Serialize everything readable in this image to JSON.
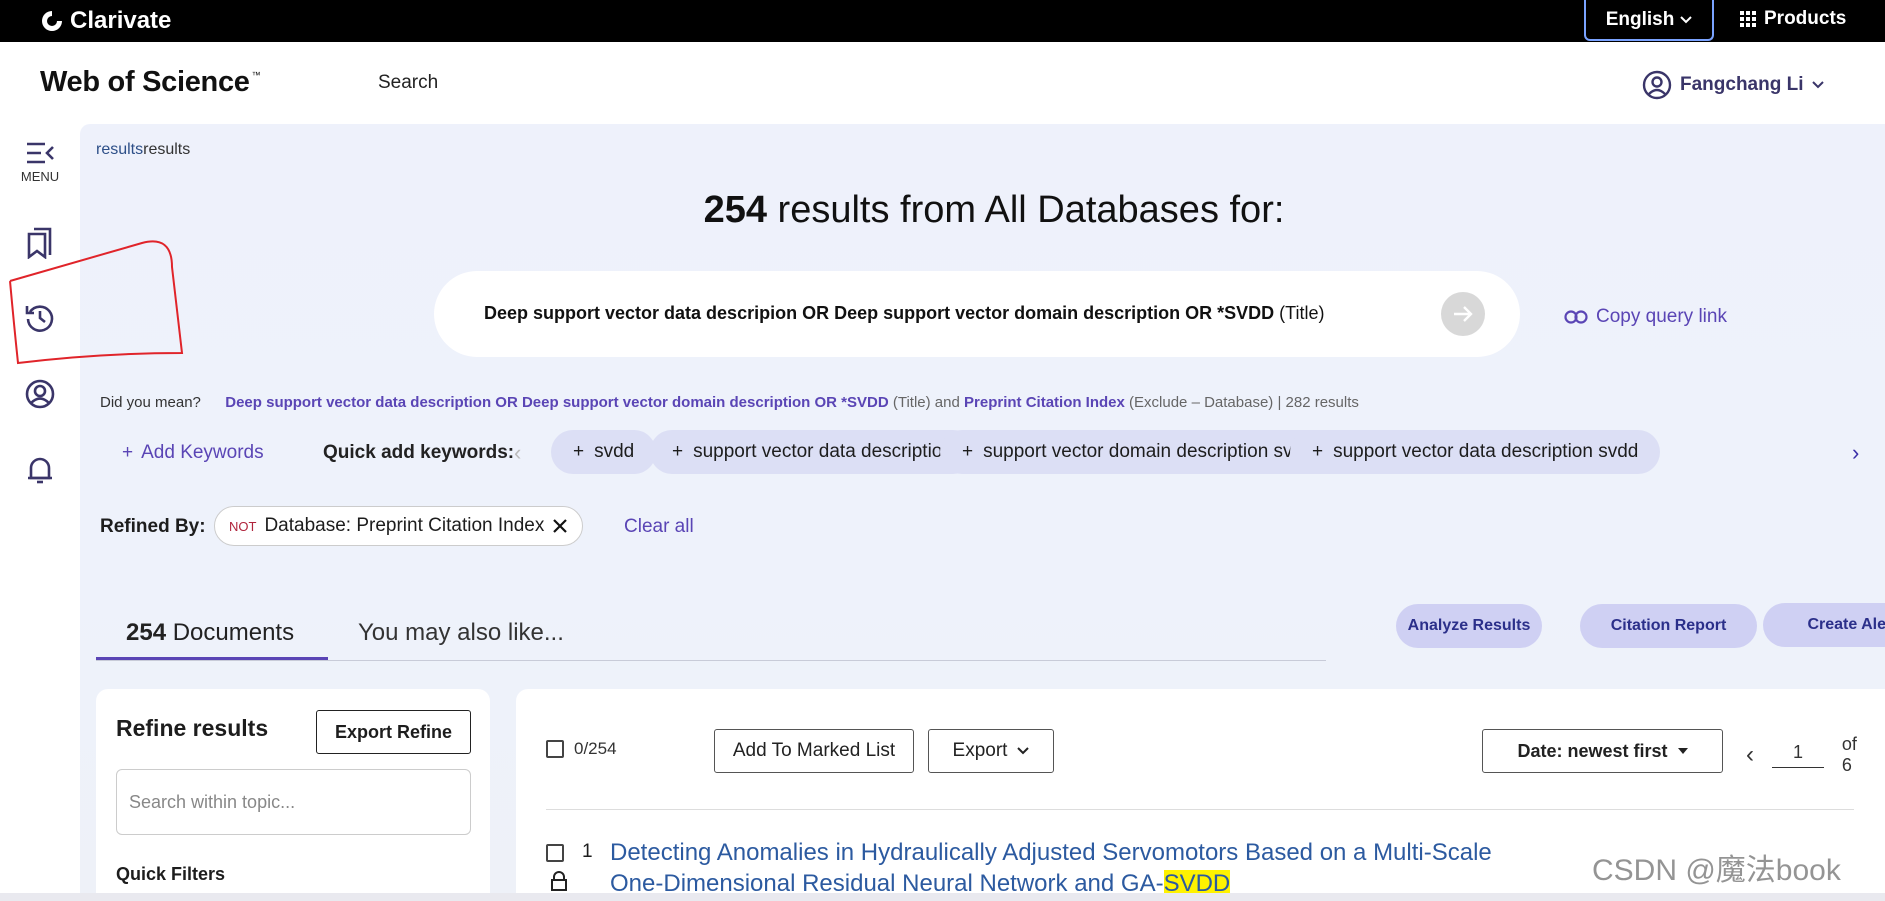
{
  "topbar": {
    "brand": "Clarivate",
    "language": "English",
    "products": "Products"
  },
  "header": {
    "logo": "Web of Science",
    "logo_tm": "™",
    "nav_search": "Search",
    "user_name": "Fangchang Li"
  },
  "sidebar": {
    "menu_label": "MENU",
    "items": [
      {
        "icon": "menu-collapse-icon"
      },
      {
        "icon": "bookmark-list-icon"
      },
      {
        "icon": "history-icon"
      },
      {
        "icon": "profile-icon"
      },
      {
        "icon": "bell-icon"
      }
    ]
  },
  "breadcrumb": {
    "link": "results",
    "current": "results"
  },
  "results_header": {
    "count": "254",
    "text": " results from All Databases for:"
  },
  "query": {
    "text": "Deep support vector data descripion OR Deep support vector domain description OR *SVDD",
    "field": " (Title)",
    "copy_link": "Copy query link"
  },
  "did_you_mean": {
    "label": "Did you mean?",
    "suggestion": "Deep support vector data description OR Deep support vector domain description OR *SVDD",
    "field": " (Title) and ",
    "index": "Preprint Citation Index",
    "tail": " (Exclude – Database) | 282 results"
  },
  "keywords": {
    "add_label": "Add Keywords",
    "quick_label": "Quick add keywords:",
    "chips": [
      "svdd",
      "support vector data description",
      "support vector domain description svdd",
      "support vector data description svdd"
    ]
  },
  "refined": {
    "label": "Refined By:",
    "not_tag": "NOT",
    "filter": "Database: Preprint Citation Index",
    "clear": "Clear all"
  },
  "tabs": {
    "documents_count": "254",
    "documents_label": " Documents",
    "also_like": "You may also like..."
  },
  "actions": {
    "analyze": "Analyze Results",
    "citation": "Citation Report",
    "alert": "Create Alert"
  },
  "refine_panel": {
    "title": "Refine results",
    "export_refine": "Export Refine",
    "search_placeholder": "Search within topic...",
    "quick_filters": "Quick Filters"
  },
  "results_toolbar": {
    "selected": "0/254",
    "add_marked": "Add To Marked List",
    "export": "Export",
    "sort": "Date: newest first",
    "page": "1",
    "of_pages": "of 6"
  },
  "result_1": {
    "index": "1",
    "title_line1": "Detecting Anomalies in Hydraulically Adjusted Servomotors Based on a Multi-Scale",
    "title_line2": "One-Dimensional Residual Neural Network and GA-",
    "title_highlight": "SVDD"
  },
  "watermark": "CSDN @魔法book",
  "colors": {
    "accent": "#5a45b5",
    "chip_bg": "#dcdff5",
    "action_bg": "#cfd0f3",
    "link_title": "#2c5aa0",
    "annotation_red": "#e0242a"
  }
}
